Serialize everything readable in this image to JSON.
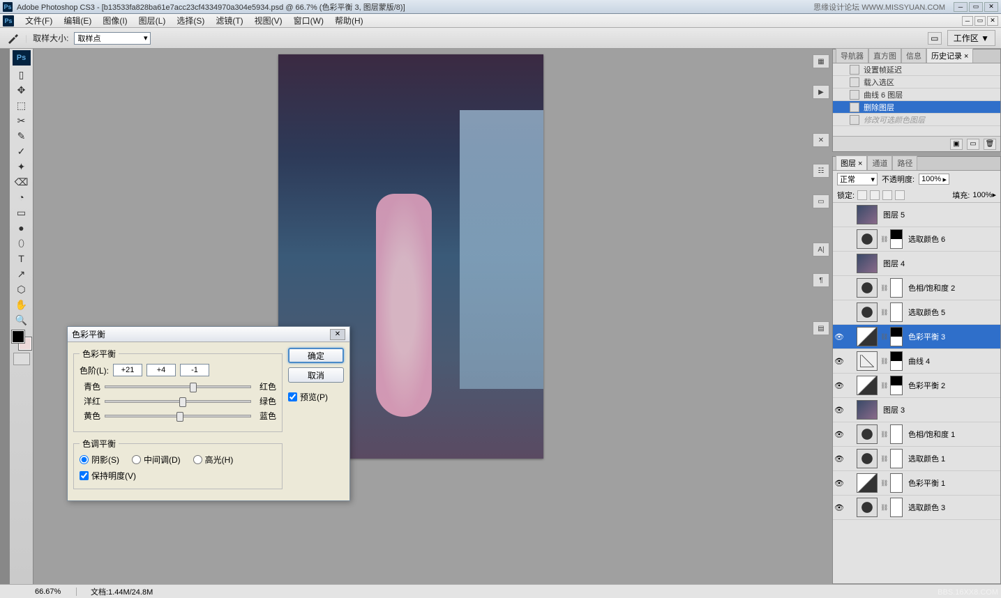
{
  "titlebar": {
    "app": "Adobe Photoshop CS3",
    "doc": "[b13533fa828ba61e7acc23cf4334970a304e5934.psd @ 66.7% (色彩平衡 3, 图层蒙版/8)]",
    "watermark_top": "思缘设计论坛  WWW.MISSYUAN.COM"
  },
  "menu": {
    "file": "文件(F)",
    "edit": "编辑(E)",
    "image": "图像(I)",
    "layer": "图层(L)",
    "select": "选择(S)",
    "filter": "滤镜(T)",
    "view": "视图(V)",
    "window": "窗口(W)",
    "help": "帮助(H)"
  },
  "options": {
    "sample_label": "取样大小:",
    "sample_value": "取样点",
    "workspace": "工作区 ▼"
  },
  "history_panel": {
    "tabs": {
      "nav": "导航器",
      "histo": "直方图",
      "info": "信息",
      "history": "历史记录 ×"
    },
    "items": [
      {
        "label": "设置帧延迟",
        "sel": false,
        "dim": false
      },
      {
        "label": "载入选区",
        "sel": false,
        "dim": false
      },
      {
        "label": "曲线 6 图层",
        "sel": false,
        "dim": false
      },
      {
        "label": "删除图层",
        "sel": true,
        "dim": false
      },
      {
        "label": "修改可选颜色图层",
        "sel": false,
        "dim": true
      }
    ]
  },
  "layers_panel": {
    "tabs": {
      "layers": "图层 ×",
      "channels": "通道",
      "paths": "路径"
    },
    "blend": "正常",
    "opacity_lbl": "不透明度:",
    "opacity": "100%",
    "lock_lbl": "锁定:",
    "fill_lbl": "填充:",
    "fill": "100%",
    "layers": [
      {
        "vis": false,
        "type": "img",
        "mask": false,
        "name": "图层 5"
      },
      {
        "vis": false,
        "type": "adj",
        "mask": true,
        "maskdark": true,
        "name": "选取颜色 6"
      },
      {
        "vis": false,
        "type": "img",
        "mask": false,
        "name": "图层 4"
      },
      {
        "vis": false,
        "type": "adj",
        "mask": true,
        "name": "色相/饱和度 2"
      },
      {
        "vis": false,
        "type": "adj",
        "mask": true,
        "name": "选取颜色 5"
      },
      {
        "vis": true,
        "type": "bal",
        "mask": true,
        "maskdark": true,
        "name": "色彩平衡 3",
        "sel": true
      },
      {
        "vis": true,
        "type": "curves",
        "mask": true,
        "maskdark": true,
        "name": "曲线 4"
      },
      {
        "vis": true,
        "type": "bal",
        "mask": true,
        "maskdark": true,
        "name": "色彩平衡 2"
      },
      {
        "vis": true,
        "type": "img",
        "mask": false,
        "name": "图层 3"
      },
      {
        "vis": true,
        "type": "adj",
        "mask": true,
        "name": "色相/饱和度 1"
      },
      {
        "vis": true,
        "type": "adj",
        "mask": true,
        "name": "选取颜色 1"
      },
      {
        "vis": true,
        "type": "bal",
        "mask": true,
        "name": "色彩平衡 1"
      },
      {
        "vis": true,
        "type": "adj",
        "mask": true,
        "name": "选取颜色 3"
      }
    ]
  },
  "dialog": {
    "title": "色彩平衡",
    "group1": "色彩平衡",
    "level_lbl": "色阶(L):",
    "l1": "+21",
    "l2": "+4",
    "l3": "-1",
    "cyan": "青色",
    "red": "红色",
    "magenta": "洋红",
    "green": "绿色",
    "yellow": "黄色",
    "blue": "蓝色",
    "group2": "色调平衡",
    "shadows": "阴影(S)",
    "midtones": "中间调(D)",
    "highlights": "高光(H)",
    "preserve": "保持明度(V)",
    "ok": "确定",
    "cancel": "取消",
    "preview": "预览(P)"
  },
  "status": {
    "zoom": "66.67%",
    "doc": "文档:1.44M/24.8M"
  },
  "watermark_bot": "BBS.16XX8.COM",
  "tools": [
    "▯",
    "✥",
    "⬚",
    "✂",
    "✎",
    "✓",
    "✦",
    "⌫",
    "◔",
    "▭",
    "●",
    "⬯",
    "T",
    "↗",
    "⬡",
    "✋",
    "🔍"
  ]
}
